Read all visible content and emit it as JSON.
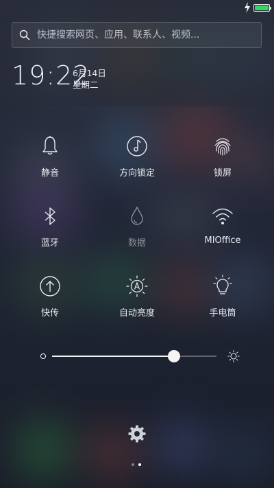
{
  "status_bar": {
    "charging_icon": "lightning-icon",
    "battery_level": 1.0,
    "battery_color": "#3ad46a"
  },
  "search": {
    "placeholder": "快捷搜索网页、应用、联系人、视频..."
  },
  "clock": {
    "time": "19:22",
    "date": "6月14日",
    "weekday": "星期二"
  },
  "toggles": [
    {
      "label": "静音",
      "icon": "bell-icon",
      "enabled": true
    },
    {
      "label": "方向锁定",
      "icon": "rotation-lock-icon",
      "enabled": true
    },
    {
      "label": "锁屏",
      "icon": "fingerprint-icon",
      "enabled": true
    },
    {
      "label": "蓝牙",
      "icon": "bluetooth-icon",
      "enabled": true
    },
    {
      "label": "数据",
      "icon": "droplet-icon",
      "enabled": false
    },
    {
      "label": "MIOffice",
      "icon": "wifi-icon",
      "enabled": true
    },
    {
      "label": "快传",
      "icon": "upload-circle-icon",
      "enabled": true
    },
    {
      "label": "自动亮度",
      "icon": "auto-brightness-icon",
      "enabled": true
    },
    {
      "label": "手电筒",
      "icon": "lightbulb-icon",
      "enabled": true
    }
  ],
  "brightness": {
    "level": 0.74,
    "min_icon": "dim-brightness-icon",
    "max_icon": "sun-icon"
  },
  "footer": {
    "settings_icon": "gear-icon",
    "page_count": 2,
    "active_page": 2
  },
  "colors": {
    "accent": "#ffffff",
    "disabled": "#8a8e99"
  }
}
